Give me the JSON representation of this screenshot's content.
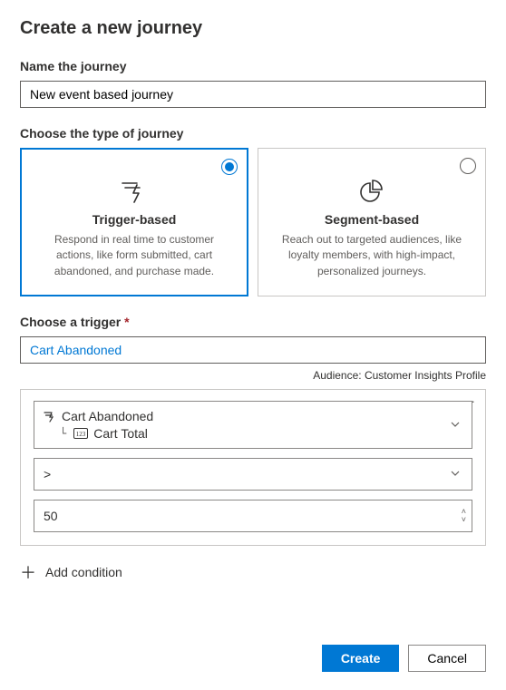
{
  "title": "Create a new journey",
  "name_section": {
    "label": "Name the journey",
    "value": "New event based journey"
  },
  "type_section": {
    "label": "Choose the type of journey",
    "cards": [
      {
        "title": "Trigger-based",
        "description": "Respond in real time to customer actions, like form submitted, cart abandoned, and purchase made.",
        "selected": true
      },
      {
        "title": "Segment-based",
        "description": "Reach out to targeted audiences, like loyalty members, with high-impact, personalized journeys.",
        "selected": false
      }
    ]
  },
  "trigger_section": {
    "label": "Choose a trigger ",
    "value": "Cart Abandoned",
    "audience_label": "Audience: ",
    "audience_value": "Customer Insights Profile"
  },
  "condition": {
    "attribute_event": "Cart Abandoned",
    "attribute_field": "Cart Total",
    "operator": ">",
    "value": "50"
  },
  "add_condition_label": "Add condition",
  "footer": {
    "primary": "Create",
    "secondary": "Cancel"
  }
}
